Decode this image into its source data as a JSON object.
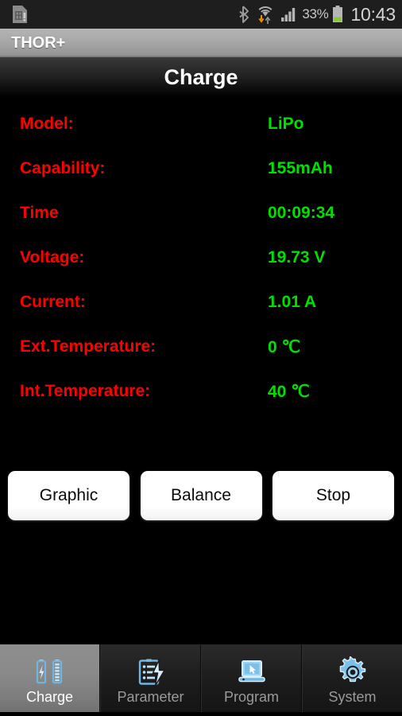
{
  "statusbar": {
    "sim_icon": "sim-card-alert-icon",
    "bluetooth_icon": "bluetooth-icon",
    "wifi_icon": "wifi-icon",
    "data_arrows_icon": "data-transfer-arrows-icon",
    "signal_icon": "cellular-signal-icon",
    "battery_percent": "33%",
    "battery_icon": "battery-icon",
    "time": "10:43"
  },
  "appbar": {
    "title": "THOR+"
  },
  "screen": {
    "title": "Charge"
  },
  "readouts": [
    {
      "label": "Model:",
      "value": "LiPo"
    },
    {
      "label": "Capability:",
      "value": "155mAh"
    },
    {
      "label": "Time",
      "value": "00:09:34"
    },
    {
      "label": "Voltage:",
      "value": "19.73  V"
    },
    {
      "label": "Current:",
      "value": "1.01  A"
    },
    {
      "label": "Ext.Temperature:",
      "value": "0  ℃"
    },
    {
      "label": "Int.Temperature:",
      "value": "40  ℃"
    }
  ],
  "buttons": [
    {
      "label": "Graphic"
    },
    {
      "label": "Balance"
    },
    {
      "label": "Stop"
    }
  ],
  "tabs": [
    {
      "label": "Charge",
      "icon": "charging-batteries-icon",
      "active": true
    },
    {
      "label": "Parameter",
      "icon": "clipboard-bolt-icon",
      "active": false
    },
    {
      "label": "Program",
      "icon": "laptop-cursor-icon",
      "active": false
    },
    {
      "label": "System",
      "icon": "gear-icon",
      "active": false
    }
  ],
  "colors": {
    "label_red": "#ff0000",
    "value_green": "#00e000",
    "icon_blue": "#7ec4ee",
    "battery_green": "#8cc63f"
  }
}
